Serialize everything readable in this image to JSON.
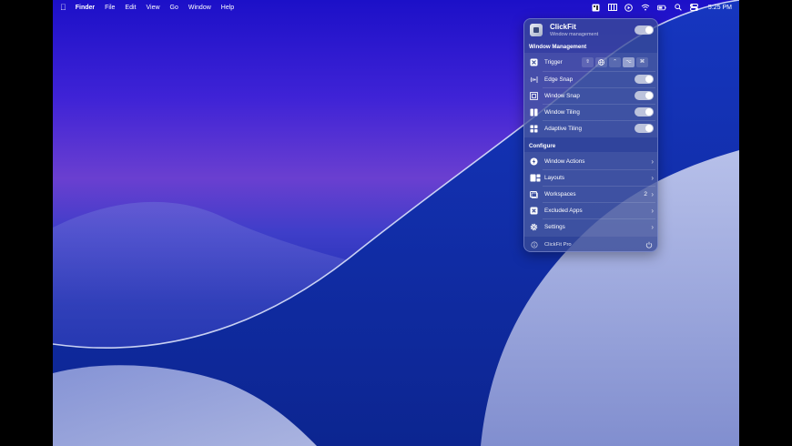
{
  "menubar": {
    "app": "Finder",
    "menus": [
      "File",
      "Edit",
      "View",
      "Go",
      "Window",
      "Help"
    ],
    "clock": "5:25 PM"
  },
  "panel": {
    "app_name": "ClickFit",
    "app_subtitle": "Window management",
    "section_window_management": "Window Management",
    "trigger_label": "Trigger",
    "trigger_keys": [
      "⇧",
      "🌐",
      "⌃",
      "⌥",
      "⌘"
    ],
    "window_management_items": [
      {
        "label": "Edge Snap",
        "icon": "edge-snap-icon",
        "enabled": true
      },
      {
        "label": "Window Snap",
        "icon": "window-snap-icon",
        "enabled": true
      },
      {
        "label": "Window Tiling",
        "icon": "window-tiling-icon",
        "enabled": true
      },
      {
        "label": "Adaptive Tiling",
        "icon": "adaptive-tiling-icon",
        "enabled": true
      }
    ],
    "section_configure": "Configure",
    "configure_items": [
      {
        "label": "Window Actions",
        "icon": "lightning-icon",
        "count": ""
      },
      {
        "label": "Layouts",
        "icon": "layouts-icon",
        "count": ""
      },
      {
        "label": "Workspaces",
        "icon": "workspaces-icon",
        "count": "2"
      },
      {
        "label": "Excluded Apps",
        "icon": "excluded-apps-icon",
        "count": ""
      },
      {
        "label": "Settings",
        "icon": "gear-icon",
        "count": ""
      }
    ],
    "footer_label": "ClickFit Pro"
  },
  "colors": {
    "panel_bg": "#384a96",
    "desktop_top": "#1c10c8",
    "desktop_bottom": "#0f2a9c"
  }
}
